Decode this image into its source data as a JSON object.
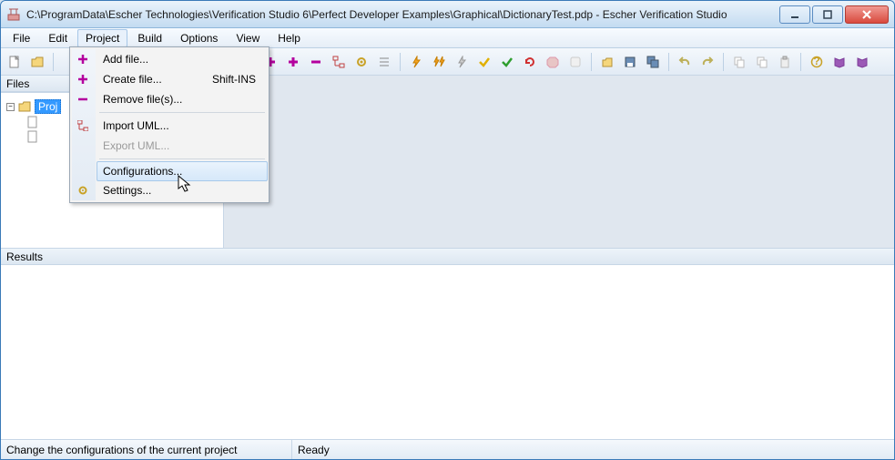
{
  "window": {
    "title": "C:\\ProgramData\\Escher Technologies\\Verification Studio 6\\Perfect Developer Examples\\Graphical\\DictionaryTest.pdp - Escher Verification Studio"
  },
  "menubar": {
    "items": [
      "File",
      "Edit",
      "Project",
      "Build",
      "Options",
      "View",
      "Help"
    ],
    "open_index": 2
  },
  "project_menu": {
    "items": [
      {
        "label": "Add file...",
        "icon": "plus-magenta",
        "enabled": true,
        "shortcut": ""
      },
      {
        "label": "Create file...",
        "icon": "plus-magenta",
        "enabled": true,
        "shortcut": "Shift-INS"
      },
      {
        "label": "Remove file(s)...",
        "icon": "minus-magenta",
        "enabled": true,
        "shortcut": ""
      },
      {
        "sep": true
      },
      {
        "label": "Import UML...",
        "icon": "uml",
        "enabled": true,
        "shortcut": ""
      },
      {
        "label": "Export UML...",
        "icon": "",
        "enabled": false,
        "shortcut": ""
      },
      {
        "sep": true
      },
      {
        "label": "Configurations...",
        "icon": "",
        "enabled": true,
        "shortcut": "",
        "hovered": true
      },
      {
        "label": "Settings...",
        "icon": "gear",
        "enabled": true,
        "shortcut": ""
      }
    ]
  },
  "files_panel": {
    "title": "Files",
    "root": "Proj",
    "children": [
      "",
      ""
    ]
  },
  "results_panel": {
    "title": "Results"
  },
  "statusbar": {
    "hint": "Change the configurations of the current project",
    "state": "Ready"
  },
  "colors": {
    "accent": "#3399ff"
  }
}
